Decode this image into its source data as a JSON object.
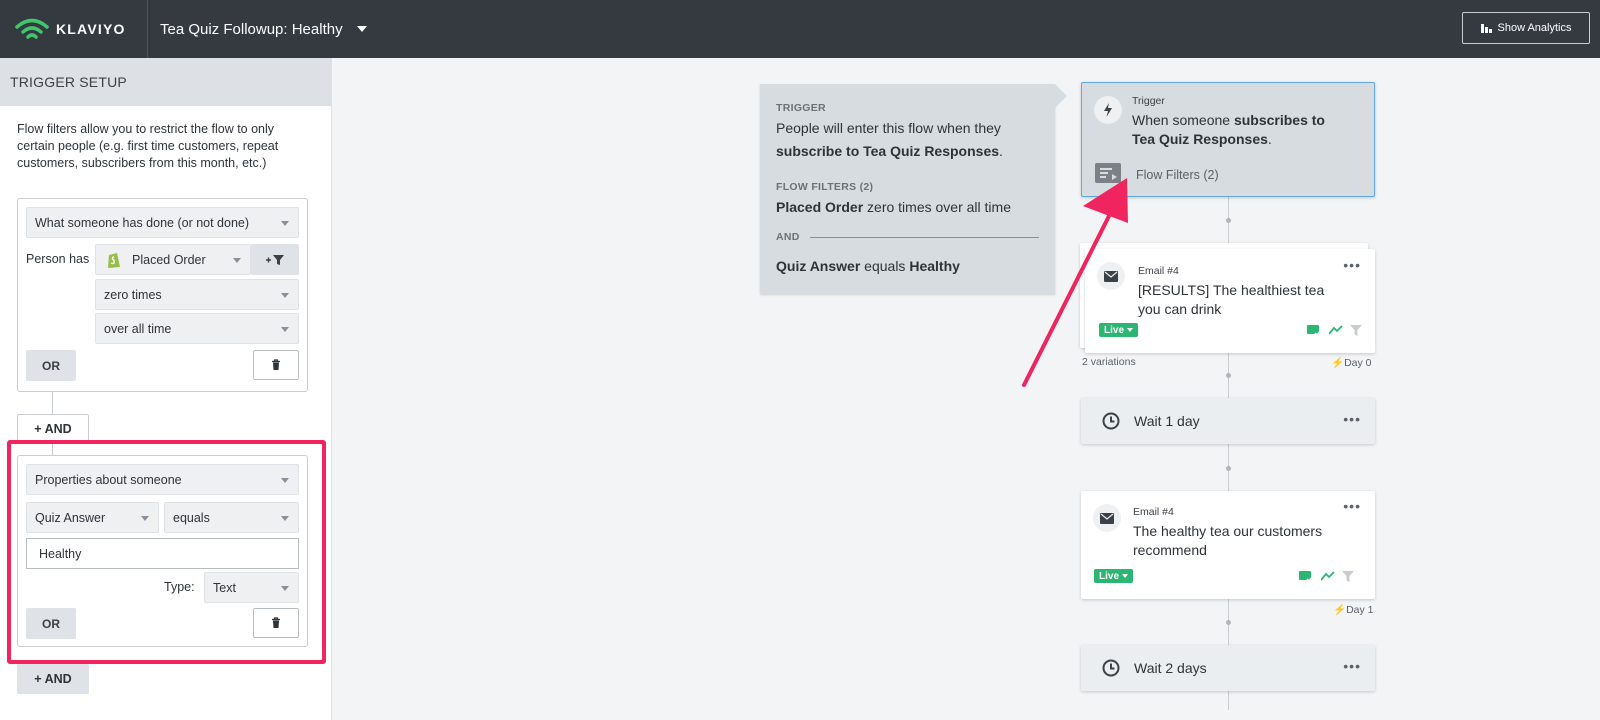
{
  "header": {
    "brand": "KLAVIYO",
    "flow_title": "Tea Quiz Followup: Healthy",
    "analytics_label": "Show Analytics"
  },
  "sidebar": {
    "title": "TRIGGER SETUP",
    "intro": "Flow filters allow you to restrict the flow to only certain people (e.g. first time customers, repeat customers, subscribers from this month, etc.)",
    "filter1": {
      "type": "What someone has done (or not done)",
      "person_has": "Person has",
      "metric": "Placed Order",
      "count": "zero times",
      "timeframe": "over all time",
      "or_label": "OR"
    },
    "and_label": "+ AND",
    "filter2": {
      "type": "Properties about someone",
      "property": "Quiz Answer",
      "operator": "equals",
      "value": "Healthy",
      "type_label": "Type:",
      "value_type": "Text",
      "or_label": "OR"
    },
    "and_label_2": "+ AND"
  },
  "tooltip": {
    "trigger_label": "TRIGGER",
    "trigger_text_a": "People will enter this flow when they",
    "trigger_text_b": "subscribe to Tea Quiz Responses",
    "trigger_text_c": ".",
    "filters_label": "FLOW FILTERS (2)",
    "filter1_bold": "Placed Order",
    "filter1_rest": " zero times over all time",
    "and_label": "AND",
    "filter2_bold_a": "Quiz Answer",
    "filter2_mid": " equals ",
    "filter2_bold_b": "Healthy"
  },
  "trigger_node": {
    "label": "Trigger",
    "text_a": "When someone ",
    "text_b": "subscribes to",
    "text_c": "Tea Quiz Responses",
    "text_d": ".",
    "filters": "Flow Filters (2)"
  },
  "email1": {
    "label": "Email #4",
    "title_a": "[RESULTS] The healthiest tea",
    "title_b": "you can drink",
    "status": "Live",
    "variations": "2 variations",
    "day": "Day 0"
  },
  "wait1": {
    "label": "Wait 1 day"
  },
  "email2": {
    "label": "Email #4",
    "title_a": "The healthy tea our customers",
    "title_b": "recommend",
    "status": "Live",
    "day": "Day 1"
  },
  "wait2": {
    "label": "Wait 2 days"
  },
  "colors": {
    "topbar": "#343a40",
    "highlight": "#f0245e",
    "live": "#2bb673",
    "trigger_border": "#5fa7e0"
  }
}
